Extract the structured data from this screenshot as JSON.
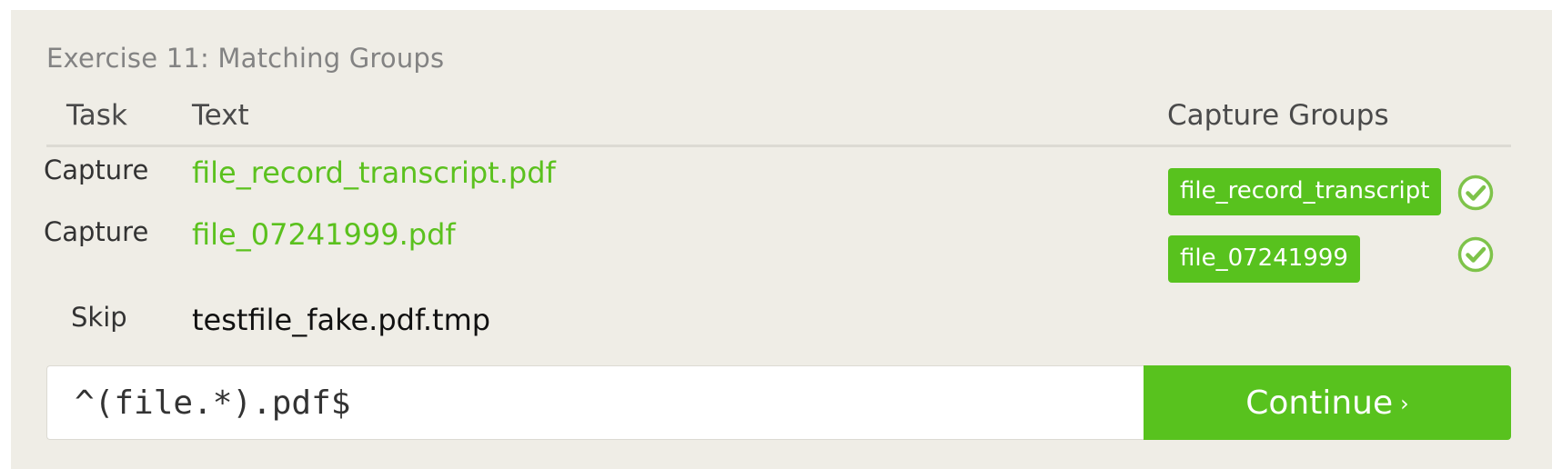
{
  "exercise": {
    "title": "Exercise 11: Matching Groups"
  },
  "table": {
    "headers": {
      "task": "Task",
      "text": "Text",
      "capture_groups": "Capture Groups"
    },
    "rows": [
      {
        "task": "Capture",
        "text": "file_record_transcript.pdf",
        "status": "match",
        "group": "file_record_transcript",
        "check_icon": "check-circle-icon"
      },
      {
        "task": "Capture",
        "text": "file_07241999.pdf",
        "status": "match",
        "group": "file_07241999",
        "check_icon": "check-circle-icon"
      },
      {
        "task": "Skip",
        "text": "testfile_fake.pdf.tmp",
        "status": "skip"
      }
    ]
  },
  "regex_input": {
    "value": "^(file.*).pdf$"
  },
  "continue_button": {
    "label": "Continue",
    "chevron": "›"
  },
  "colors": {
    "accent": "#58c21e",
    "panel_bg": "#efede6",
    "match_text": "#5bc11e"
  }
}
